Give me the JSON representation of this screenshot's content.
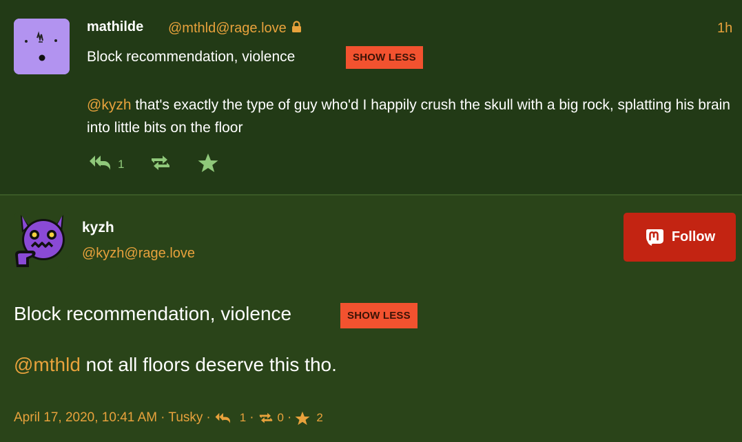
{
  "status1": {
    "display_name": "mathilde",
    "handle": "@mthld@rage.love",
    "time": "1h",
    "content_warning": "Block recommendation, violence",
    "show_less_label": "SHOW LESS",
    "mention": "@kyzh",
    "text": " that's exactly the type of guy who'd I happily crush the skull with a big rock, splatting his brain into little bits on the floor",
    "reply_count": "1",
    "icons": {
      "lock": "lock-icon",
      "reply": "reply-all-icon",
      "boost": "boost-icon",
      "favourite": "star-icon"
    },
    "avatar_bg": "#b293f0"
  },
  "status2": {
    "display_name": "kyzh",
    "handle": "@kyzh@rage.love",
    "follow_label": "Follow",
    "content_warning": "Block recommendation, violence",
    "show_less_label": "SHOW LESS",
    "mention": "@mthld",
    "text": " not all floors deserve this tho.",
    "meta": {
      "date": "April 17, 2020, 10:41 AM",
      "separator": "·",
      "app": "Tusky",
      "replies": "1",
      "boosts": "0",
      "favourites": "2"
    },
    "icons": {
      "follow": "mastodon-logo-icon",
      "reply": "reply-all-icon",
      "boost": "boost-icon",
      "favourite": "star-icon"
    },
    "avatar_bg": "#7b3fc4"
  },
  "colors": {
    "background": "#2a4419",
    "background_dark": "#223a16",
    "accent": "#e8a23c",
    "warning": "#f2522f",
    "follow": "#c32412",
    "action": "#8fc87a"
  }
}
